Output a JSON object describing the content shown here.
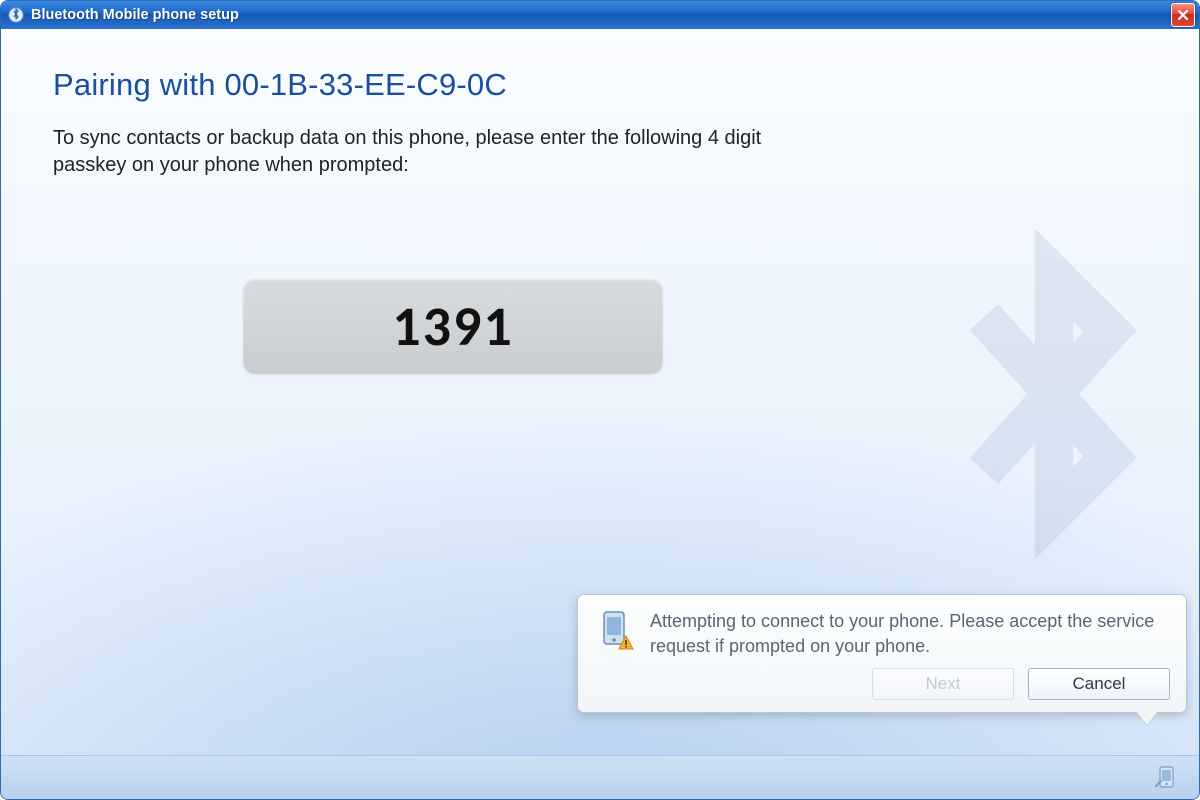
{
  "window": {
    "title": "Bluetooth Mobile phone setup"
  },
  "main": {
    "heading": "Pairing with 00-1B-33-EE-C9-0C",
    "instruction": "To sync contacts or backup data on this phone, please enter the following 4 digit passkey on your phone when prompted:",
    "passkey": "1391"
  },
  "buttons": {
    "next": "Next",
    "cancel": "Cancel"
  },
  "balloon": {
    "message": "Attempting to connect to your phone. Please accept the service request if prompted on your phone."
  }
}
